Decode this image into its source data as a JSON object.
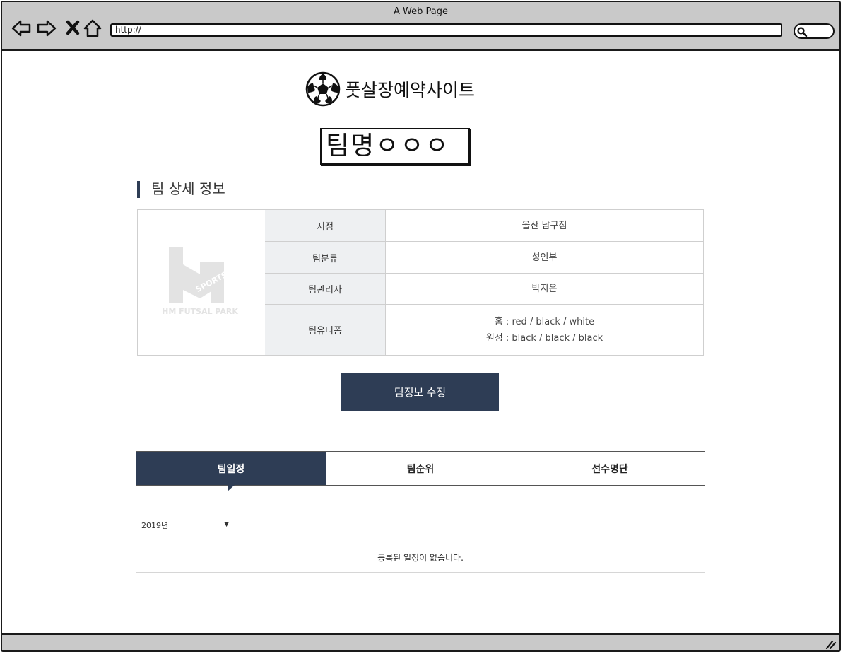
{
  "window": {
    "title": "A Web Page",
    "url": "http://"
  },
  "site": {
    "name": "풋살장예약사이트"
  },
  "team": {
    "name_label": "팀명ㅇㅇㅇ"
  },
  "section": {
    "title": "팀 상세 정보"
  },
  "logo": {
    "badge_text": "SPORTS",
    "caption": "HM FUTSAL PARK"
  },
  "info_rows": [
    {
      "label": "지점",
      "value": "울산 남구점"
    },
    {
      "label": "팀분류",
      "value": "성인부"
    },
    {
      "label": "팀관리자",
      "value": "박지은"
    },
    {
      "label": "팀유니폼",
      "value": "홈 : red / black / white",
      "value2": "원정 : black / black / black"
    }
  ],
  "actions": {
    "edit_label": "팀정보 수정"
  },
  "tabs": [
    {
      "label": "팀일정",
      "active": true
    },
    {
      "label": "팀순위",
      "active": false
    },
    {
      "label": "선수명단",
      "active": false
    }
  ],
  "schedule": {
    "year_selected": "2019년",
    "empty_message": "등록된 일정이 없습니다."
  },
  "colors": {
    "accent": "#2e3d55",
    "label_bg": "#eef0f2",
    "chrome": "#c9c9c9"
  }
}
